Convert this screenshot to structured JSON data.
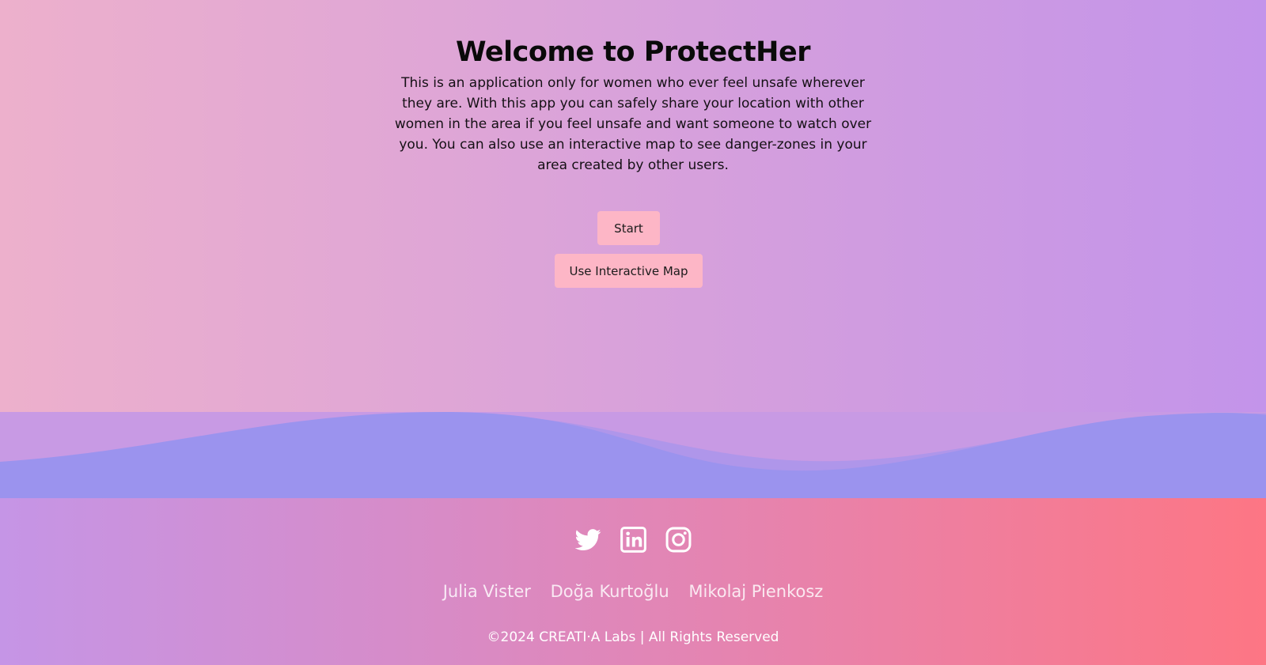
{
  "hero": {
    "title": "Welcome to ProtectHer",
    "description": "This is an application only for women who ever feel unsafe wherever they are. With this app you can safely share your location with other women in the area if you feel unsafe and want someone to watch over you. You can also use an interactive map to see danger-zones in your area created by other users.",
    "start_label": "Start",
    "map_label": "Use Interactive Map"
  },
  "footer": {
    "social": [
      {
        "icon": "twitter-icon"
      },
      {
        "icon": "linkedin-icon"
      },
      {
        "icon": "instagram-icon"
      }
    ],
    "authors": [
      "Julia Vister",
      "Doğa Kurtoğlu",
      "Mikolaj Pienkosz"
    ],
    "copyright": "©2024 CREATI·A Labs | All Rights Reserved"
  },
  "colors": {
    "button": "#fdb6c6",
    "wave_back": "#c89ae4",
    "wave_front": "#9b93ee",
    "footer_start": "#c595e6",
    "footer_end": "#fd7684"
  }
}
